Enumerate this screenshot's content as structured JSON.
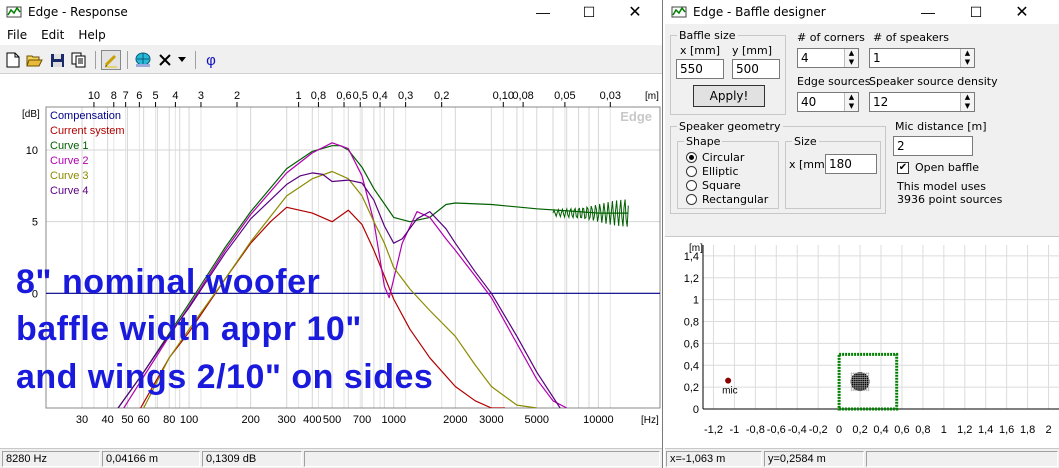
{
  "left_window": {
    "title": "Edge - Response",
    "menu": [
      "File",
      "Edit",
      "Help"
    ],
    "toolbar_icons": [
      "new-icon",
      "open-icon",
      "save-icon",
      "copy-icon",
      "pen-icon",
      "globe-icon",
      "delete-icon",
      "dropdown-icon",
      "phi-icon"
    ],
    "phi_label": "φ",
    "status": {
      "freq": "8280 Hz",
      "distance": "0,04166 m",
      "level": "0,1309 dB"
    }
  },
  "overlay": {
    "line1": "8\" nominal woofer",
    "line2": "baffle width appr 10\"",
    "line3": "and wings 2/10\" on sides"
  },
  "chart_data": {
    "type": "line",
    "watermark": "Edge",
    "ylabel": "[dB]",
    "xlabel": "[Hz]",
    "top_unit": "[m]",
    "x_scale": "log",
    "xlim": [
      20,
      20000
    ],
    "ylim": [
      -8,
      13
    ],
    "y_ticks": [
      0,
      5,
      10
    ],
    "y_tick_labels": [
      "0",
      "5",
      "10"
    ],
    "x_ticks": [
      30,
      40,
      50,
      60,
      80,
      100,
      200,
      300,
      400,
      500,
      700,
      1000,
      2000,
      3000,
      5000,
      10000
    ],
    "x_tick_labels": [
      "30",
      "40",
      "50",
      "60",
      "80",
      "100",
      "200",
      "300",
      "400",
      "500",
      "700",
      "1000",
      "2000",
      "3000",
      "5000",
      "10000"
    ],
    "top_ticks_m": [
      10,
      8,
      7,
      6,
      5,
      4,
      3,
      2,
      1,
      0.8,
      0.6,
      0.5,
      0.4,
      0.3,
      0.2,
      0.1,
      0.08,
      0.05,
      0.03
    ],
    "top_tick_labels": [
      "10",
      "8",
      "7",
      "6",
      "5",
      "4",
      "3",
      "2",
      "1",
      "0,8",
      "0,6",
      "0,5",
      "0,4",
      "0,3",
      "0,2",
      "0,10",
      "0,08",
      "0,05",
      "0,03"
    ],
    "legend": [
      "Compensation",
      "Current system",
      "Curve 1",
      "Curve 2",
      "Curve 3",
      "Curve 4"
    ],
    "series": [
      {
        "name": "Compensation",
        "color": "#00008b",
        "x": [
          20,
          20000
        ],
        "y": [
          0,
          0
        ]
      },
      {
        "name": "Current system",
        "color": "#b00000",
        "x": [
          58,
          80,
          100,
          150,
          200,
          250,
          300,
          400,
          500,
          600,
          700,
          800,
          900,
          1000,
          1200,
          1500,
          2000,
          2500,
          3000,
          3500
        ],
        "y": [
          -8,
          -4.5,
          -2.7,
          1.0,
          3.5,
          5.0,
          6.0,
          5.6,
          5.0,
          5.8,
          4.8,
          3.0,
          1.2,
          -0.4,
          -2.5,
          -4.5,
          -6.5,
          -7.5,
          -8,
          -8
        ]
      },
      {
        "name": "Curve 1",
        "color": "#006000",
        "x": [
          45,
          60,
          80,
          100,
          150,
          200,
          300,
          400,
          500,
          550,
          600,
          700,
          800,
          1000,
          1200,
          1500,
          1800,
          2000,
          3000,
          5000,
          8000,
          10000,
          14000
        ],
        "y": [
          -8,
          -5.5,
          -2.8,
          -0.7,
          3.2,
          5.7,
          8.7,
          9.9,
          10.3,
          10.3,
          10.0,
          8.8,
          7.3,
          5.3,
          5.0,
          5.3,
          6.2,
          6.3,
          6.2,
          5.9,
          5.7,
          5.6,
          5.6
        ]
      },
      {
        "name": "Curve 2",
        "color": "#b000b0",
        "x": [
          48,
          60,
          80,
          100,
          150,
          200,
          300,
          400,
          500,
          600,
          700,
          800,
          900,
          950,
          1000,
          1100,
          1300,
          1500,
          1800,
          2000,
          2500,
          3000,
          4000,
          5000,
          6000,
          7000
        ],
        "y": [
          -8,
          -5.8,
          -3.0,
          -0.9,
          3.0,
          5.5,
          8.4,
          9.8,
          10.5,
          10.1,
          8.2,
          5.0,
          0.5,
          -0.3,
          1.0,
          3.5,
          5.7,
          5.3,
          3.8,
          3.0,
          1.2,
          -0.3,
          -3.5,
          -6.0,
          -7.5,
          -8
        ]
      },
      {
        "name": "Curve 3",
        "color": "#8b8b00",
        "x": [
          60,
          80,
          100,
          150,
          200,
          300,
          400,
          500,
          600,
          700,
          800,
          900,
          1000,
          1200,
          1500,
          2000,
          2500,
          3000,
          4000,
          5000
        ],
        "y": [
          -8,
          -4.5,
          -2.5,
          1.0,
          3.6,
          6.8,
          8.0,
          8.5,
          8.0,
          6.8,
          5.0,
          3.5,
          1.8,
          0.3,
          -1.2,
          -3.0,
          -5.0,
          -6.5,
          -7.8,
          -8
        ]
      },
      {
        "name": "Curve 4",
        "color": "#5a0080",
        "x": [
          45,
          60,
          80,
          100,
          150,
          200,
          300,
          350,
          400,
          450,
          500,
          600,
          700,
          800,
          900,
          1000,
          1100,
          1300,
          1500,
          1800,
          2000,
          2500,
          3000,
          4000,
          5000,
          6500
        ],
        "y": [
          -8,
          -5.5,
          -2.9,
          -1.0,
          2.8,
          5.2,
          7.6,
          8.2,
          8.4,
          8.3,
          7.8,
          7.9,
          7.7,
          6.5,
          4.7,
          3.5,
          3.8,
          5.2,
          5.7,
          4.5,
          3.5,
          1.5,
          0,
          -3.0,
          -5.5,
          -8
        ]
      }
    ]
  },
  "right_window": {
    "title": "Edge - Baffle designer",
    "baffle_size": {
      "group": "Baffle size",
      "x_label": "x [mm]",
      "y_label": "y [mm]",
      "x_value": "550",
      "y_value": "500",
      "apply": "Apply!"
    },
    "corners": {
      "label": "# of corners",
      "value": "4"
    },
    "speakers": {
      "label": "# of speakers",
      "value": "1"
    },
    "edge_sources": {
      "label": "Edge sources",
      "value": "40"
    },
    "density": {
      "label": "Speaker source density",
      "value": "12"
    },
    "geometry": {
      "group": "Speaker geometry",
      "shape_group": "Shape",
      "size_group": "Size",
      "options": [
        "Circular",
        "Elliptic",
        "Square",
        "Rectangular"
      ],
      "selected": "Circular",
      "size_label": "x [mm]",
      "size_value": "180"
    },
    "mic": {
      "label": "Mic distance [m]",
      "value": "2",
      "open_baffle": "Open baffle",
      "model_info1": "This model uses",
      "model_info2": "3936 point sources"
    },
    "layout": {
      "unit": "[m]",
      "y_ticks": [
        1.4,
        1.2,
        1,
        0.8,
        0.6,
        0.4,
        0.2,
        0
      ],
      "y_tick_labels": [
        "1,4",
        "1,2",
        "1",
        "0,8",
        "0,6",
        "0,4",
        "0,2",
        "0"
      ],
      "x_ticks": [
        -1.2,
        -1,
        -0.8,
        -0.6,
        -0.4,
        -0.2,
        0,
        0.2,
        0.4,
        0.6,
        0.8,
        1,
        1.2,
        1.4,
        1.6,
        1.8,
        2
      ],
      "x_tick_labels": [
        "-1,2",
        "-1",
        "-0,8",
        "-0,6",
        "-0,4",
        "-0,2",
        "0",
        "0,2",
        "0,4",
        "0,6",
        "0,8",
        "1",
        "1,2",
        "1,4",
        "1,6",
        "1,8",
        "2"
      ],
      "mic_label": "mic",
      "mic_x": -1.06,
      "mic_y": 0.26,
      "baffle_w": 0.55,
      "baffle_h": 0.5,
      "speaker_x": 0.2,
      "speaker_y": 0.25,
      "speaker_d": 0.18
    },
    "status": {
      "x": "x=-1,063 m",
      "y": "y=0,2584 m"
    }
  },
  "colors": {
    "overlay": "#1a1adc",
    "baffle": "#008000",
    "grid": "#c8c8c8"
  }
}
